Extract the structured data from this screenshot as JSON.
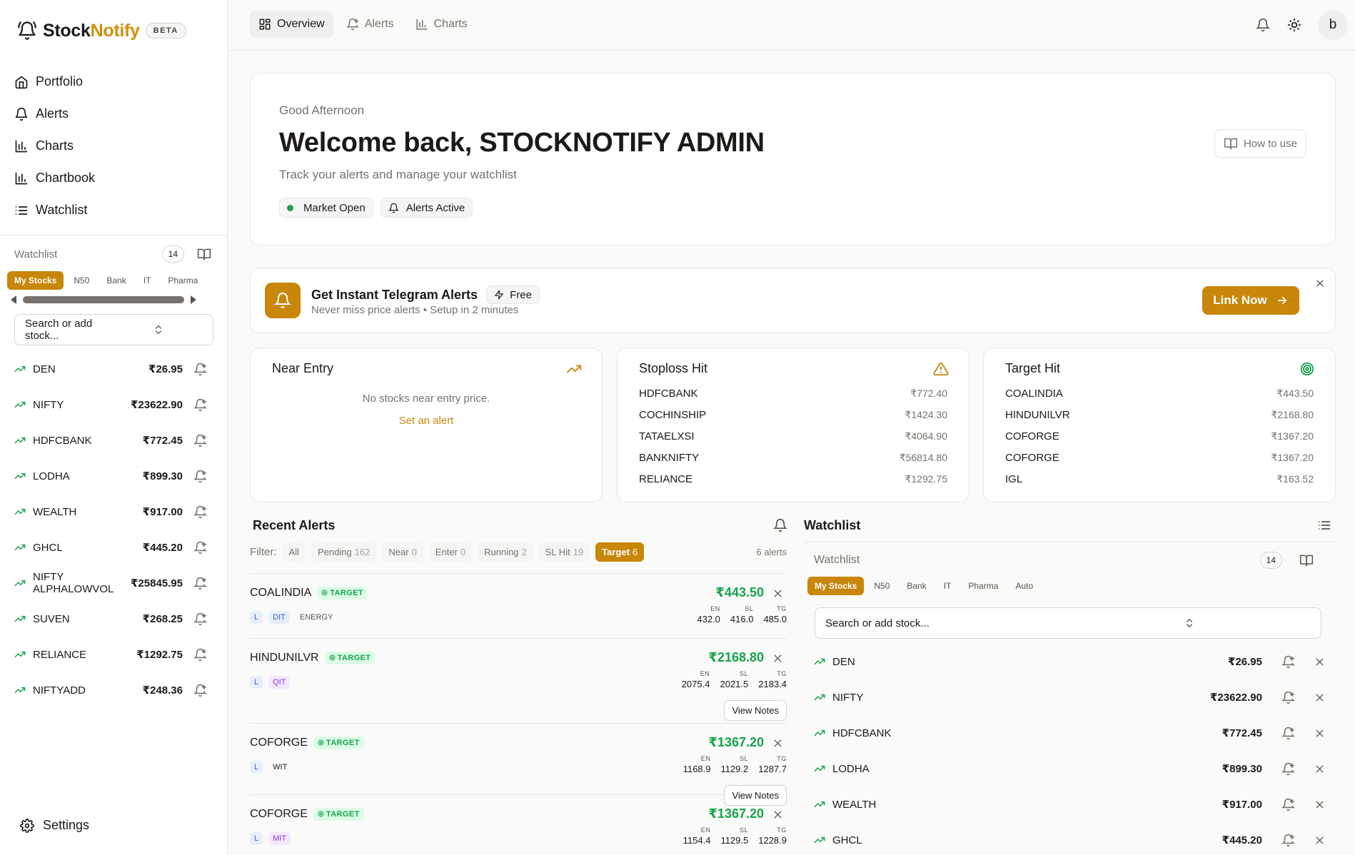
{
  "app": {
    "name_part1": "Stock",
    "name_part2": "Notify",
    "beta": "BETA"
  },
  "nav": [
    {
      "label": "Portfolio",
      "icon": "home-icon"
    },
    {
      "label": "Alerts",
      "icon": "bell-icon"
    },
    {
      "label": "Charts",
      "icon": "bar-chart-icon"
    },
    {
      "label": "Chartbook",
      "icon": "bar-chart-icon"
    },
    {
      "label": "Watchlist",
      "icon": "list-icon"
    }
  ],
  "sidebar_watchlist": {
    "title": "Watchlist",
    "count": "14",
    "chips": [
      "My Stocks",
      "N50",
      "Bank",
      "IT",
      "Pharma"
    ],
    "search_placeholder": "Search or add stock...",
    "stocks": [
      {
        "symbol": "DEN",
        "price": "₹26.95"
      },
      {
        "symbol": "NIFTY",
        "price": "₹23622.90"
      },
      {
        "symbol": "HDFCBANK",
        "price": "₹772.45"
      },
      {
        "symbol": "LODHA",
        "price": "₹899.30"
      },
      {
        "symbol": "WEALTH",
        "price": "₹917.00"
      },
      {
        "symbol": "GHCL",
        "price": "₹445.20"
      },
      {
        "symbol": "NIFTY ALPHALOWVOL",
        "price": "₹25845.95"
      },
      {
        "symbol": "SUVEN",
        "price": "₹268.25"
      },
      {
        "symbol": "RELIANCE",
        "price": "₹1292.75"
      },
      {
        "symbol": "NIFTYADD",
        "price": "₹248.36"
      }
    ]
  },
  "settings_label": "Settings",
  "topbar": {
    "tabs": [
      {
        "label": "Overview",
        "icon": "grid-icon"
      },
      {
        "label": "Alerts",
        "icon": "bell-plus-icon"
      },
      {
        "label": "Charts",
        "icon": "bar-chart-icon"
      }
    ],
    "avatar": "b"
  },
  "welcome": {
    "greeting": "Good Afternoon",
    "title": "Welcome back, STOCKNOTIFY ADMIN",
    "subtitle": "Track your alerts and manage your watchlist",
    "market": "Market Open",
    "alerts": "Alerts Active",
    "how_to": "How to use"
  },
  "telegram": {
    "title": "Get Instant Telegram Alerts",
    "free": "Free",
    "subtitle": "Never miss price alerts • Setup in 2 minutes",
    "button": "Link Now"
  },
  "near_entry": {
    "title": "Near Entry",
    "empty": "No stocks near entry price.",
    "link": "Set an alert"
  },
  "stoploss_hit": {
    "title": "Stoploss Hit",
    "rows": [
      {
        "symbol": "HDFCBANK",
        "price": "₹772.40"
      },
      {
        "symbol": "COCHINSHIP",
        "price": "₹1424.30"
      },
      {
        "symbol": "TATAELXSI",
        "price": "₹4064.90"
      },
      {
        "symbol": "BANKNIFTY",
        "price": "₹56814.80"
      },
      {
        "symbol": "RELIANCE",
        "price": "₹1292.75"
      }
    ]
  },
  "target_hit": {
    "title": "Target Hit",
    "rows": [
      {
        "symbol": "COALINDIA",
        "price": "₹443.50"
      },
      {
        "symbol": "HINDUNILVR",
        "price": "₹2168.80"
      },
      {
        "symbol": "COFORGE",
        "price": "₹1367.20"
      },
      {
        "symbol": "COFORGE",
        "price": "₹1367.20"
      },
      {
        "symbol": "IGL",
        "price": "₹163.52"
      }
    ]
  },
  "recent_alerts": {
    "title": "Recent Alerts",
    "filter_label": "Filter:",
    "filters": [
      {
        "label": "All",
        "count": ""
      },
      {
        "label": "Pending",
        "count": "162"
      },
      {
        "label": "Near",
        "count": "0"
      },
      {
        "label": "Enter",
        "count": "0"
      },
      {
        "label": "Running",
        "count": "2"
      },
      {
        "label": "SL Hit",
        "count": "19"
      },
      {
        "label": "Target",
        "count": "6"
      }
    ],
    "count_text": "6 alerts",
    "items": [
      {
        "symbol": "COALINDIA",
        "status": "TARGET",
        "tag1": "L",
        "tag2": "DIT",
        "sector": "ENERGY",
        "price": "₹443.50",
        "en": "432.0",
        "sl": "416.0",
        "tg": "485.0",
        "notes": ""
      },
      {
        "symbol": "HINDUNILVR",
        "status": "TARGET",
        "tag1": "L",
        "tag2": "QIT",
        "sector": "",
        "price": "₹2168.80",
        "en": "2075.4",
        "sl": "2021.5",
        "tg": "2183.4",
        "notes": "View Notes"
      },
      {
        "symbol": "COFORGE",
        "status": "TARGET",
        "tag1": "L",
        "tag2": "WIT",
        "sector": "",
        "price": "₹1367.20",
        "en": "1168.9",
        "sl": "1129.2",
        "tg": "1287.7",
        "notes": "View Notes"
      },
      {
        "symbol": "COFORGE",
        "status": "TARGET",
        "tag1": "L",
        "tag2": "MIT",
        "sector": "",
        "price": "₹1367.20",
        "en": "1154.4",
        "sl": "1129.5",
        "tg": "1228.9",
        "notes": ""
      }
    ],
    "level_labels": {
      "en": "EN",
      "sl": "SL",
      "tg": "TG"
    }
  },
  "right_watchlist": {
    "title": "Watchlist",
    "sub_title": "Watchlist",
    "count": "14",
    "chips": [
      "My Stocks",
      "N50",
      "Bank",
      "IT",
      "Pharma",
      "Auto"
    ],
    "search_placeholder": "Search or add stock...",
    "stocks": [
      {
        "symbol": "DEN",
        "price": "₹26.95"
      },
      {
        "symbol": "NIFTY",
        "price": "₹23622.90"
      },
      {
        "symbol": "HDFCBANK",
        "price": "₹772.45"
      },
      {
        "symbol": "LODHA",
        "price": "₹899.30"
      },
      {
        "symbol": "WEALTH",
        "price": "₹917.00"
      },
      {
        "symbol": "GHCL",
        "price": "₹445.20"
      }
    ]
  },
  "colors": {
    "accent": "#c8860b",
    "up": "#16a34a",
    "muted": "#78716c"
  }
}
